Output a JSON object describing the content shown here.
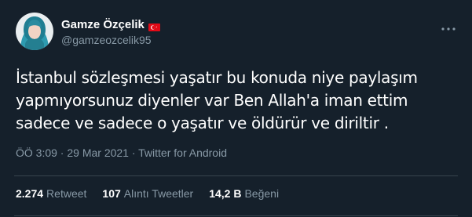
{
  "tweet": {
    "author": {
      "display_name": "Gamze Özçelik",
      "handle": "@gamzeozcelik95",
      "flag_icon": "turkey-flag-icon",
      "avatar": "avatar-photo"
    },
    "text": "İstanbul sözleşmesi yaşatır bu konuda niye paylaşım\nyapmıyorsunuz diyenler var Ben Allah'a iman ettim\nsadece ve sadece o yaşatır ve öldürür ve diriltir .",
    "meta": "ÖÖ 3:09 · 29 Mar 2021 · Twitter for Android",
    "stats": {
      "retweets": {
        "count": "2.274",
        "label": "Retweet"
      },
      "quotes": {
        "count": "107",
        "label": "Alıntı Tweetler"
      },
      "likes": {
        "count": "14,2 B",
        "label": "Beğeni"
      }
    },
    "more_icon": "more-dots-icon"
  },
  "colors": {
    "background": "#15202b",
    "text": "#ffffff",
    "secondary": "#8899a6",
    "divider": "#38444d",
    "flag_red": "#e30a17"
  }
}
